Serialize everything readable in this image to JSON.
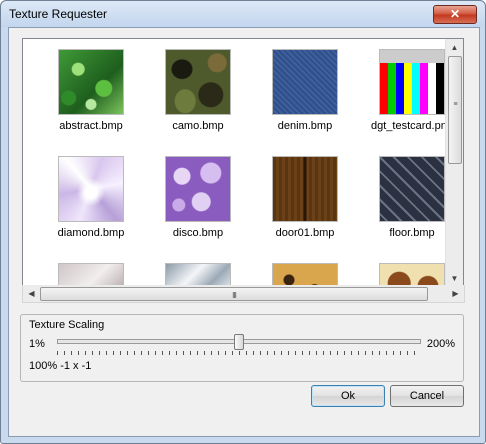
{
  "window": {
    "title": "Texture Requester",
    "close_glyph": "✕"
  },
  "textures": [
    {
      "label": "abstract.bmp",
      "pattern": "abstract"
    },
    {
      "label": "camo.bmp",
      "pattern": "camo"
    },
    {
      "label": "denim.bmp",
      "pattern": "denim"
    },
    {
      "label": "dgt_testcard.png",
      "pattern": "testcard"
    },
    {
      "label": "diamond.bmp",
      "pattern": "diamond"
    },
    {
      "label": "disco.bmp",
      "pattern": "disco"
    },
    {
      "label": "door01.bmp",
      "pattern": "door"
    },
    {
      "label": "floor.bmp",
      "pattern": "floor"
    },
    {
      "label": "",
      "pattern": "marble"
    },
    {
      "label": "",
      "pattern": "silver"
    },
    {
      "label": "",
      "pattern": "leopard"
    },
    {
      "label": "",
      "pattern": "giraffe"
    }
  ],
  "scaling": {
    "group_title": "Texture Scaling",
    "min_label": "1%",
    "max_label": "200%",
    "value_fraction": 0.5,
    "status_text": "100% -1 x -1"
  },
  "buttons": {
    "ok_label": "Ok",
    "cancel_label": "Cancel"
  },
  "scroll": {
    "vertical_thumb_fraction": 0.45,
    "grip_glyph": "III",
    "up_glyph": "▲",
    "down_glyph": "▼",
    "left_glyph": "◀",
    "right_glyph": "▶"
  }
}
